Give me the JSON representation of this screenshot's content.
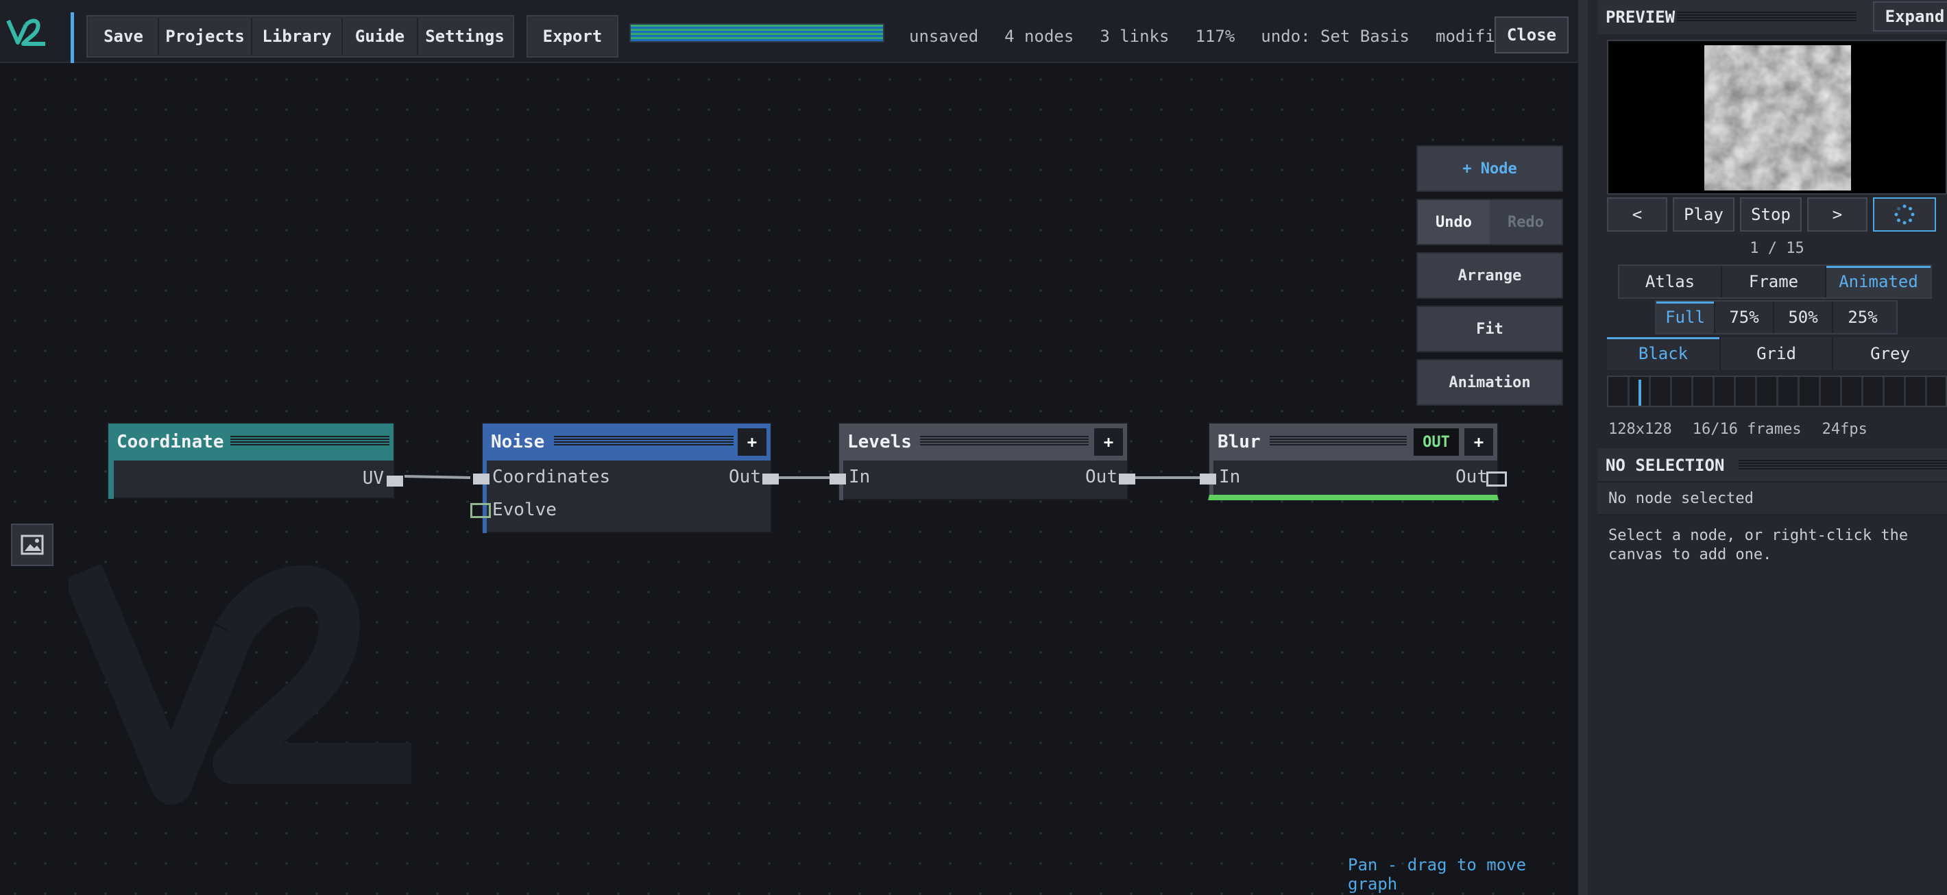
{
  "app": {
    "logo_text": "VL"
  },
  "toolbar": {
    "save": "Save",
    "projects": "Projects",
    "library": "Library",
    "guide": "Guide",
    "settings": "Settings",
    "export": "Export",
    "close": "Close",
    "progress": 1.0
  },
  "status": {
    "saved_state": "unsaved",
    "nodes": "4 nodes",
    "links": "3 links",
    "zoom": "117%",
    "undo": "undo: Set Basis",
    "modified": "modified"
  },
  "canvas_tools": {
    "add_node": "+ Node",
    "undo": "Undo",
    "redo": "Redo",
    "arrange": "Arrange",
    "fit": "Fit",
    "animation": "Animation"
  },
  "nodes": {
    "coordinate": {
      "title": "Coordinate",
      "output": "UV",
      "color": "#2e7f7f"
    },
    "noise": {
      "title": "Noise",
      "input1": "Coordinates",
      "input2": "Evolve",
      "output": "Out",
      "plus": "+",
      "color": "#3a66ad"
    },
    "levels": {
      "title": "Levels",
      "input": "In",
      "output": "Out",
      "plus": "+",
      "color": "#4a4e58"
    },
    "blur": {
      "title": "Blur",
      "input": "In",
      "output": "Out",
      "badge": "OUT",
      "plus": "+",
      "color": "#4a4e58",
      "accent": "#5fcf5f"
    }
  },
  "canvas_hint": "Pan - drag to move graph",
  "preview": {
    "title": "PREVIEW",
    "expand": "Expand",
    "prev": "<",
    "play": "Play",
    "stop": "Stop",
    "next": ">",
    "frame_counter": "1 / 15",
    "modes": [
      "Atlas",
      "Frame",
      "Animated"
    ],
    "active_mode": "Animated",
    "scales": [
      "Full",
      "75%",
      "50%",
      "25%"
    ],
    "active_scale": "Full",
    "backgrounds": [
      "Black",
      "Grid",
      "Grey"
    ],
    "active_background": "Black",
    "resolution": "128x128",
    "frames": "16/16 frames",
    "fps": "24fps"
  },
  "selection": {
    "title": "NO SELECTION",
    "status": "No node selected",
    "help": "Select a node, or right-click the\ncanvas to add one."
  }
}
